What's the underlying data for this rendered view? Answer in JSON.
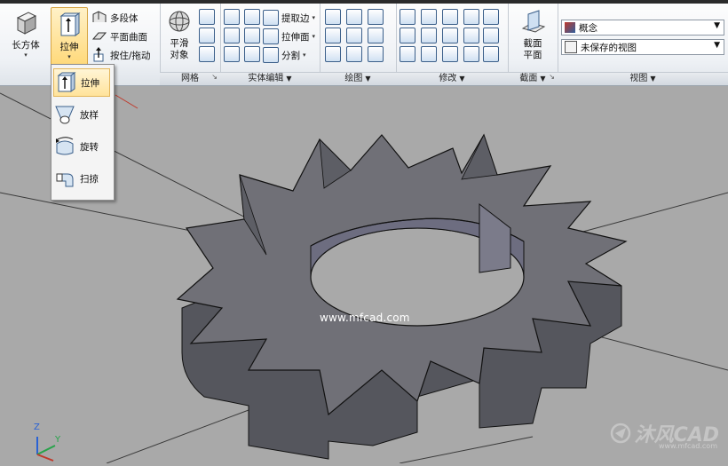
{
  "ribbon": {
    "modeling": {
      "box_label": "长方体",
      "extrude_label": "拉伸",
      "polysolid_label": "多段体",
      "planar_surface_label": "平面曲面",
      "presspull_label": "按住/拖动"
    },
    "mesh": {
      "title": "网格",
      "smooth_label_1": "平滑",
      "smooth_label_2": "对象"
    },
    "solid_edit": {
      "title": "实体编辑",
      "extract_edges_label": "提取边",
      "extrude_faces_label": "拉伸面",
      "separate_label": "分割"
    },
    "draw": {
      "title": "绘图"
    },
    "modify": {
      "title": "修改"
    },
    "section": {
      "title": "截面",
      "section_plane_1": "截面",
      "section_plane_2": "平面"
    },
    "view": {
      "title": "视图",
      "visual_style": "概念",
      "named_view": "未保存的视图"
    }
  },
  "flyout": {
    "items": [
      {
        "label": "拉伸",
        "icon": "extrude-icon"
      },
      {
        "label": "放样",
        "icon": "loft-icon"
      },
      {
        "label": "旋转",
        "icon": "revolve-icon"
      },
      {
        "label": "扫掠",
        "icon": "sweep-icon"
      }
    ]
  },
  "viewport": {
    "watermark": "www.mfcad.com",
    "logo_text": "沐风CAD",
    "logo_sub": "www.mfcad.com",
    "ucs_z": "Z",
    "ucs_y": "Y"
  },
  "colors": {
    "viewport_bg": "#a9a9a9",
    "gear_face": "#6e6e74",
    "gear_side": "#55565d",
    "accent_blue": "#3b5f8a"
  }
}
